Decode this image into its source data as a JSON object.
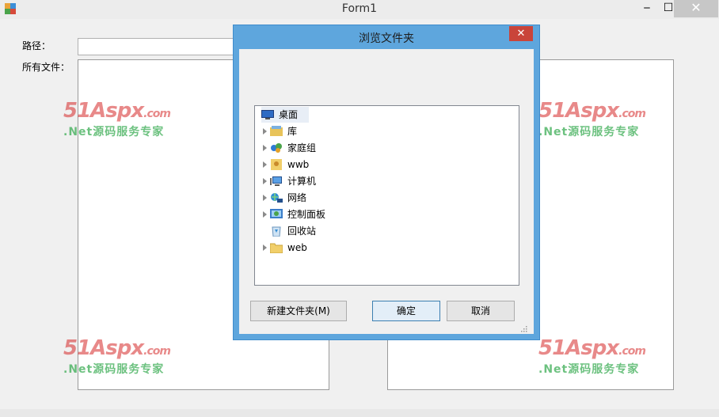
{
  "window": {
    "title": "Form1",
    "minimize_glyph": "‒",
    "maximize_glyph": "☐",
    "close_glyph": "✕"
  },
  "form": {
    "path_label": "路径：",
    "files_label": "所有文件：",
    "path_value": ""
  },
  "watermark": {
    "brand": "51Aspx",
    "brand_suffix": ".com",
    "tagline": ".Net源码服务专家"
  },
  "dialog": {
    "title": "浏览文件夹",
    "close_glyph": "✕",
    "tree": [
      {
        "label": "桌面",
        "icon": "desktop-icon",
        "expandable": false
      },
      {
        "label": "库",
        "icon": "library-icon",
        "expandable": true
      },
      {
        "label": "家庭组",
        "icon": "homegroup-icon",
        "expandable": true
      },
      {
        "label": "wwb",
        "icon": "user-folder-icon",
        "expandable": true
      },
      {
        "label": "计算机",
        "icon": "computer-icon",
        "expandable": true
      },
      {
        "label": "网络",
        "icon": "network-icon",
        "expandable": true
      },
      {
        "label": "控制面板",
        "icon": "control-panel-icon",
        "expandable": true
      },
      {
        "label": "回收站",
        "icon": "recycle-bin-icon",
        "expandable": false
      },
      {
        "label": "web",
        "icon": "folder-icon",
        "expandable": true
      }
    ],
    "new_folder_label": "新建文件夹(M)",
    "ok_label": "确定",
    "cancel_label": "取消"
  },
  "colors": {
    "dialog_frame": "#5ea6dd",
    "close_red": "#c9443a",
    "watermark_red": "#d62a2a",
    "watermark_green": "#2fa84a"
  }
}
